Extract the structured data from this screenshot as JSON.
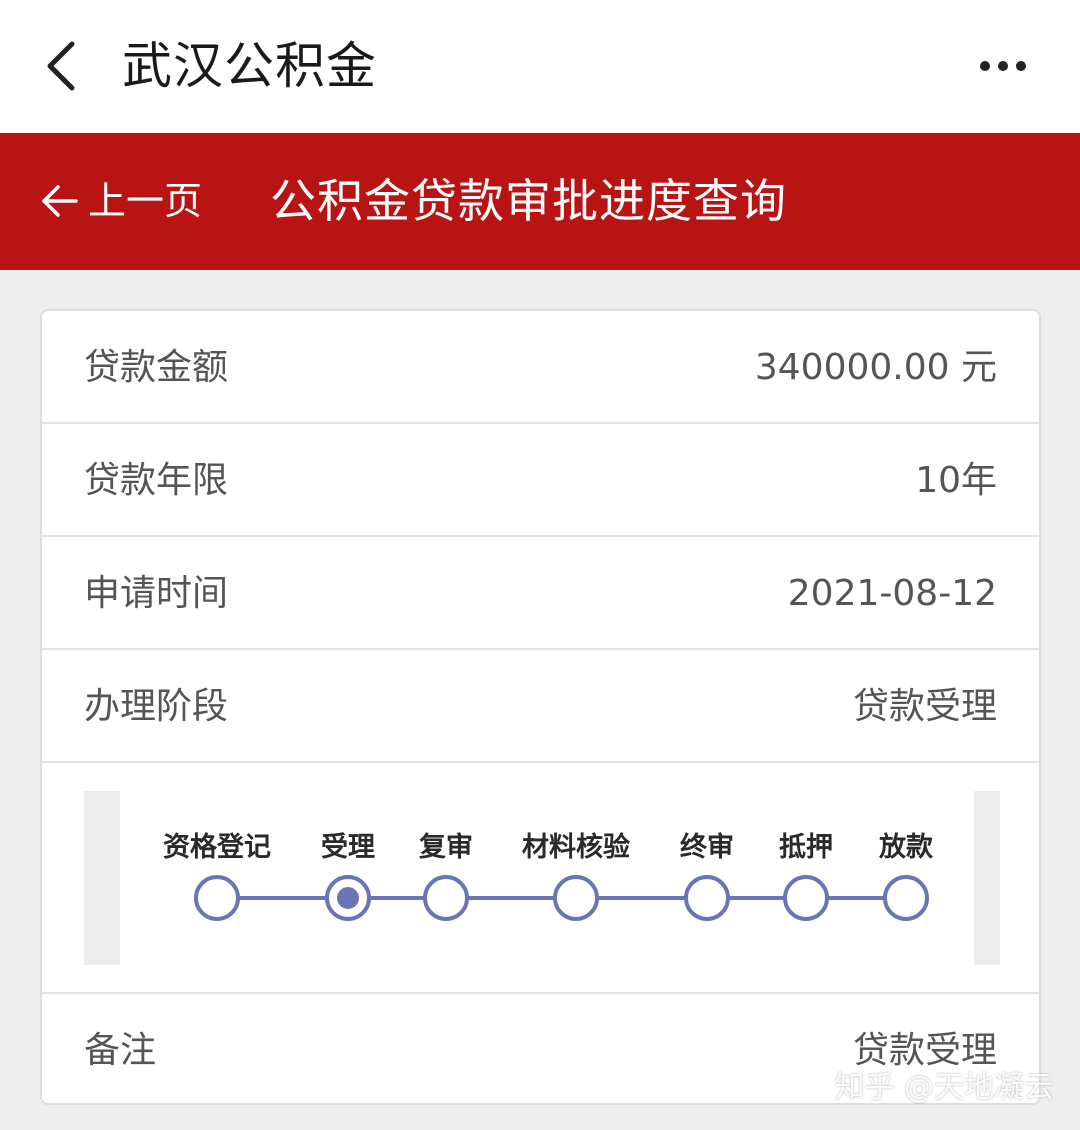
{
  "appbar": {
    "title": "武汉公积金"
  },
  "banner": {
    "prev_label": "上一页",
    "page_title": "公积金贷款审批进度查询",
    "color": "#b91414"
  },
  "details": [
    {
      "label": "贷款金额",
      "value": "340000.00 元"
    },
    {
      "label": "贷款年限",
      "value": "10年"
    },
    {
      "label": "申请时间",
      "value": "2021-08-12"
    },
    {
      "label": "办理阶段",
      "value": "贷款受理"
    }
  ],
  "progress": {
    "steps": [
      "资格登记",
      "受理",
      "复审",
      "材料核验",
      "终审",
      "抵押",
      "放款"
    ],
    "current_step": "受理",
    "accent": "#6a75b3"
  },
  "remark": {
    "label": "备注",
    "value": "贷款受理"
  },
  "watermark": "知乎 @天地凝云"
}
